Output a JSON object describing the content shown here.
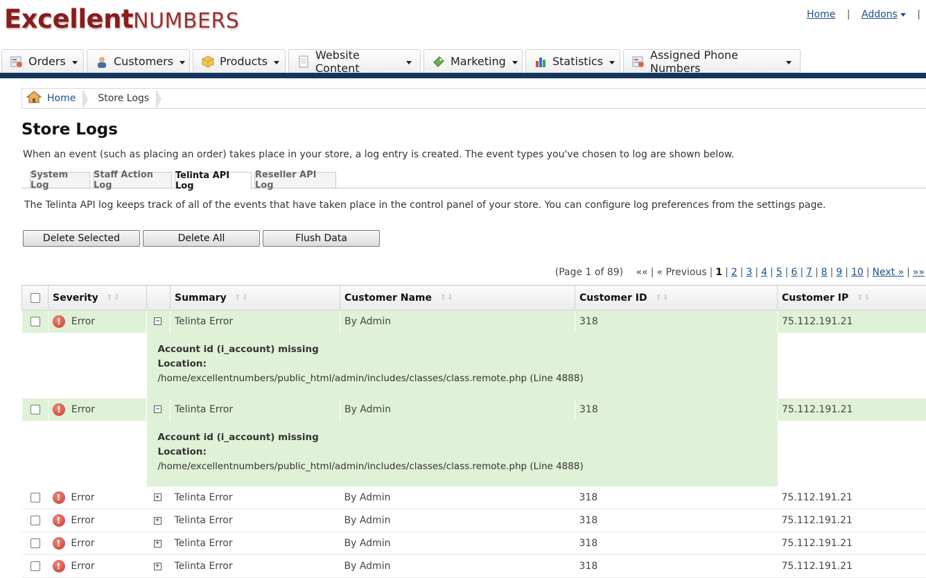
{
  "brand": {
    "bold": "Excellent",
    "thin": "Numbers"
  },
  "toplinks": {
    "home": "Home",
    "addons": "Addons",
    "sep": "|"
  },
  "nav": [
    {
      "label": "Orders",
      "icon": "orders-icon"
    },
    {
      "label": "Customers",
      "icon": "customers-icon"
    },
    {
      "label": "Products",
      "icon": "products-icon"
    },
    {
      "label": "Website Content",
      "icon": "website-content-icon"
    },
    {
      "label": "Marketing",
      "icon": "marketing-icon"
    },
    {
      "label": "Statistics",
      "icon": "statistics-icon"
    },
    {
      "label": "Assigned Phone Numbers",
      "icon": "phone-numbers-icon"
    }
  ],
  "breadcrumb": {
    "home": "Home",
    "current": "Store Logs"
  },
  "page": {
    "title": "Store Logs",
    "intro": "When an event (such as placing an order) takes place in your store, a log entry is created. The event types you've chosen to log are shown below.",
    "description": "The Telinta API log keeps track of all of the events that have taken place in the control panel of your store. You can configure log preferences from the settings page."
  },
  "tabs": [
    {
      "label": "System Log",
      "active": false
    },
    {
      "label": "Staff Action Log",
      "active": false
    },
    {
      "label": "Telinta API Log",
      "active": true
    },
    {
      "label": "Reseller API Log",
      "active": false
    }
  ],
  "buttons": {
    "delete_selected": "Delete Selected",
    "delete_all": "Delete All",
    "flush": "Flush Data"
  },
  "pagination": {
    "info": "(Page 1 of 89)",
    "first": "««",
    "prev": "« Previous",
    "current": "1",
    "pages": [
      "2",
      "3",
      "4",
      "5",
      "6",
      "7",
      "8",
      "9",
      "10"
    ],
    "next": "Next »",
    "last": "»»"
  },
  "table": {
    "headers": {
      "severity": "Severity",
      "summary": "Summary",
      "customer_name": "Customer Name",
      "customer_id": "Customer ID",
      "customer_ip": "Customer IP"
    },
    "sort_glyph": "⇧⇩",
    "rows": [
      {
        "severity": "Error",
        "summary": "Telinta Error",
        "customer_name": "By Admin",
        "customer_id": "318",
        "customer_ip": "75.112.191.21",
        "expanded": true,
        "detail": {
          "message": "Account id (i_account) missing",
          "location_label": "Location:",
          "location": "/home/excellentnumbers/public_html/admin/includes/classes/class.remote.php (Line 4888)"
        }
      },
      {
        "severity": "Error",
        "summary": "Telinta Error",
        "customer_name": "By Admin",
        "customer_id": "318",
        "customer_ip": "75.112.191.21",
        "expanded": true,
        "detail": {
          "message": "Account id (i_account) missing",
          "location_label": "Location:",
          "location": "/home/excellentnumbers/public_html/admin/includes/classes/class.remote.php (Line 4888)"
        }
      },
      {
        "severity": "Error",
        "summary": "Telinta Error",
        "customer_name": "By Admin",
        "customer_id": "318",
        "customer_ip": "75.112.191.21",
        "expanded": false
      },
      {
        "severity": "Error",
        "summary": "Telinta Error",
        "customer_name": "By Admin",
        "customer_id": "318",
        "customer_ip": "75.112.191.21",
        "expanded": false
      },
      {
        "severity": "Error",
        "summary": "Telinta Error",
        "customer_name": "By Admin",
        "customer_id": "318",
        "customer_ip": "75.112.191.21",
        "expanded": false
      },
      {
        "severity": "Error",
        "summary": "Telinta Error",
        "customer_name": "By Admin",
        "customer_id": "318",
        "customer_ip": "75.112.191.21",
        "expanded": false
      }
    ]
  }
}
